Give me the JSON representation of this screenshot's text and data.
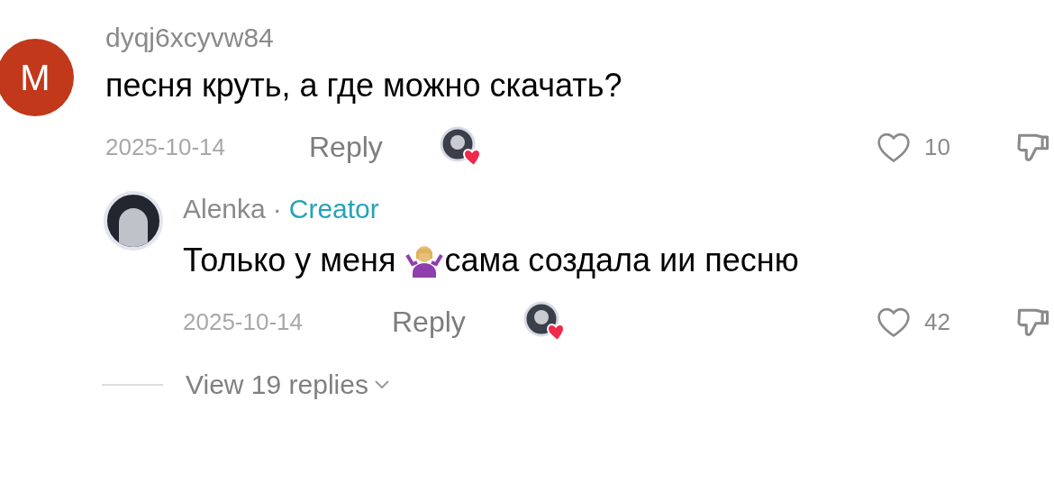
{
  "comments": [
    {
      "avatar_letter": "M",
      "username": "dyqj6xcyvw84",
      "text": "песня круть, а где можно скачать?",
      "date": "2025-10-14",
      "reply_label": "Reply",
      "likes": "10",
      "liked": false,
      "replies": [
        {
          "username": "Alenka",
          "separator": "·",
          "badge": "Creator",
          "text_before": "Только у меня",
          "text_after": "сама создала ии песню",
          "date": "2025-10-14",
          "reply_label": "Reply",
          "likes": "42",
          "liked": false
        }
      ],
      "view_replies": "View 19 replies"
    }
  ]
}
